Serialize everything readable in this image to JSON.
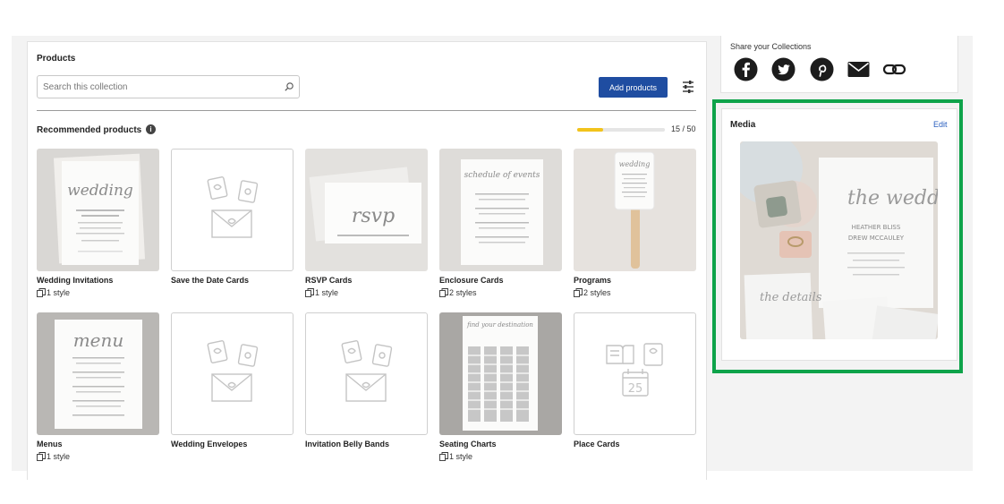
{
  "products": {
    "title": "Products",
    "search_placeholder": "Search this collection",
    "add_button": "Add products",
    "recommended_title": "Recommended products",
    "info_glyph": "i",
    "progress": {
      "current": 15,
      "max": 50,
      "label": "15 / 50"
    },
    "items": [
      {
        "name": "Wedding Invitations",
        "styles": "1 style",
        "thumb": "wedding-invitation-image",
        "script": "wedding"
      },
      {
        "name": "Save the Date Cards",
        "styles": "",
        "thumb": "placeholder-icon"
      },
      {
        "name": "RSVP Cards",
        "styles": "1 style",
        "thumb": "rsvp-card-image",
        "script": "rsvp"
      },
      {
        "name": "Enclosure Cards",
        "styles": "2 styles",
        "thumb": "enclosure-card-image",
        "script": "schedule of events"
      },
      {
        "name": "Programs",
        "styles": "2 styles",
        "thumb": "program-fan-image",
        "script": "wedding"
      },
      {
        "name": "Menus",
        "styles": "1 style",
        "thumb": "menu-card-image",
        "script": "menu"
      },
      {
        "name": "Wedding Envelopes",
        "styles": "",
        "thumb": "placeholder-icon"
      },
      {
        "name": "Invitation Belly Bands",
        "styles": "",
        "thumb": "placeholder-icon"
      },
      {
        "name": "Seating Charts",
        "styles": "1 style",
        "thumb": "seating-chart-image",
        "script": "find your destination"
      },
      {
        "name": "Place Cards",
        "styles": "",
        "thumb": "place-card-placeholder-icon"
      }
    ]
  },
  "share": {
    "title": "Share your Collections",
    "icons": [
      "facebook-icon",
      "twitter-icon",
      "pinterest-icon",
      "email-icon",
      "link-icon"
    ]
  },
  "media": {
    "title": "Media",
    "edit_label": "Edit",
    "image": "wedding-suite-photo",
    "script_main": "the wedding",
    "script_details": "the details",
    "names": "HEATHER BLISS",
    "names2": "DREW MCCAULEY"
  },
  "colors": {
    "accent_blue": "#1f4da1",
    "progress_yellow": "#f2c31c",
    "highlight_green": "#0ea34a",
    "edit_link": "#2a5fbf"
  }
}
